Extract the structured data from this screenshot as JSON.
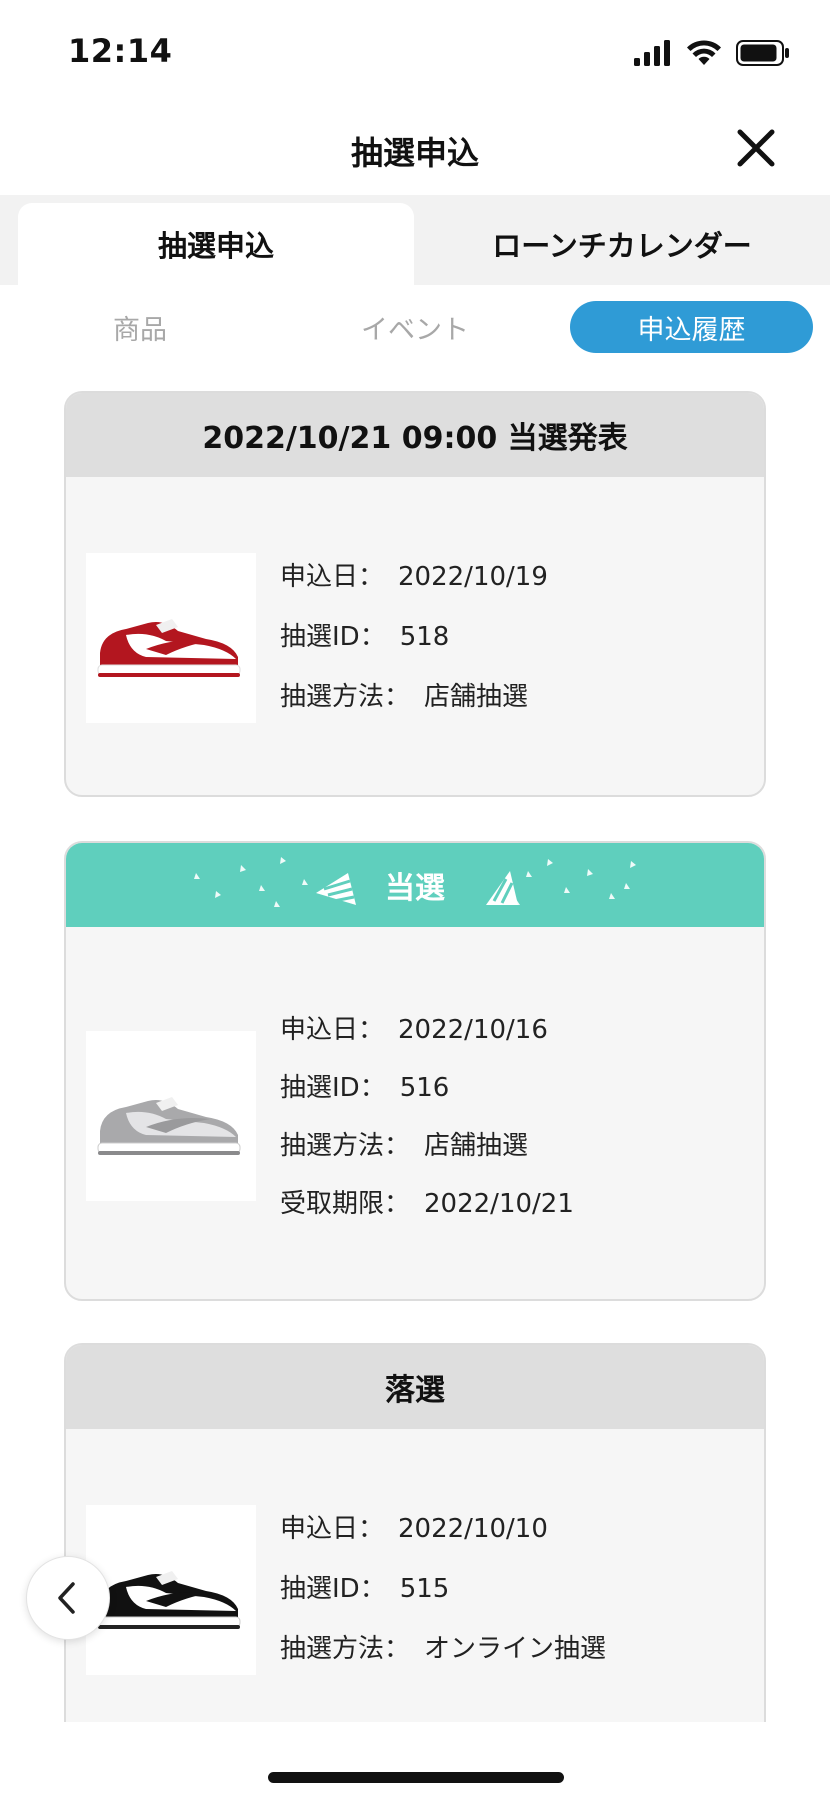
{
  "status_bar": {
    "time": "12:14",
    "icons": [
      "signal-icon",
      "wifi-icon",
      "battery-icon"
    ]
  },
  "header": {
    "title": "抽選申込",
    "close_icon": "close-icon"
  },
  "main_tabs": [
    {
      "label": "抽選申込",
      "active": true
    },
    {
      "label": "ローンチカレンダー",
      "active": false
    }
  ],
  "sub_tabs": [
    {
      "label": "商品",
      "active": false
    },
    {
      "label": "イベント",
      "active": false
    },
    {
      "label": "申込履歴",
      "active": true
    }
  ],
  "colors": {
    "accent_blue": "#2f9bd6",
    "win_teal": "#5fcfbd",
    "card_header_gray": "#dedede"
  },
  "cards": [
    {
      "header": "2022/10/21 09:00 当選発表",
      "status": "pending",
      "image": "red-white-sneaker",
      "rows": [
        {
          "label": "申込日：",
          "value": "2022/10/19"
        },
        {
          "label": "抽選ID：",
          "value": "518"
        },
        {
          "label": "抽選方法：",
          "value": "店舗抽選"
        }
      ]
    },
    {
      "header": "当選",
      "status": "won",
      "image": "gray-white-sneaker",
      "rows": [
        {
          "label": "申込日：",
          "value": "2022/10/16"
        },
        {
          "label": "抽選ID：",
          "value": "516"
        },
        {
          "label": "抽選方法：",
          "value": "店舗抽選"
        },
        {
          "label": "受取期限：",
          "value": "2022/10/21"
        }
      ]
    },
    {
      "header": "落選",
      "status": "lost",
      "image": "black-white-sneaker",
      "rows": [
        {
          "label": "申込日：",
          "value": "2022/10/10"
        },
        {
          "label": "抽選ID：",
          "value": "515"
        },
        {
          "label": "抽選方法：",
          "value": "オンライン抽選"
        }
      ]
    }
  ],
  "back_button_icon": "chevron-left-icon"
}
